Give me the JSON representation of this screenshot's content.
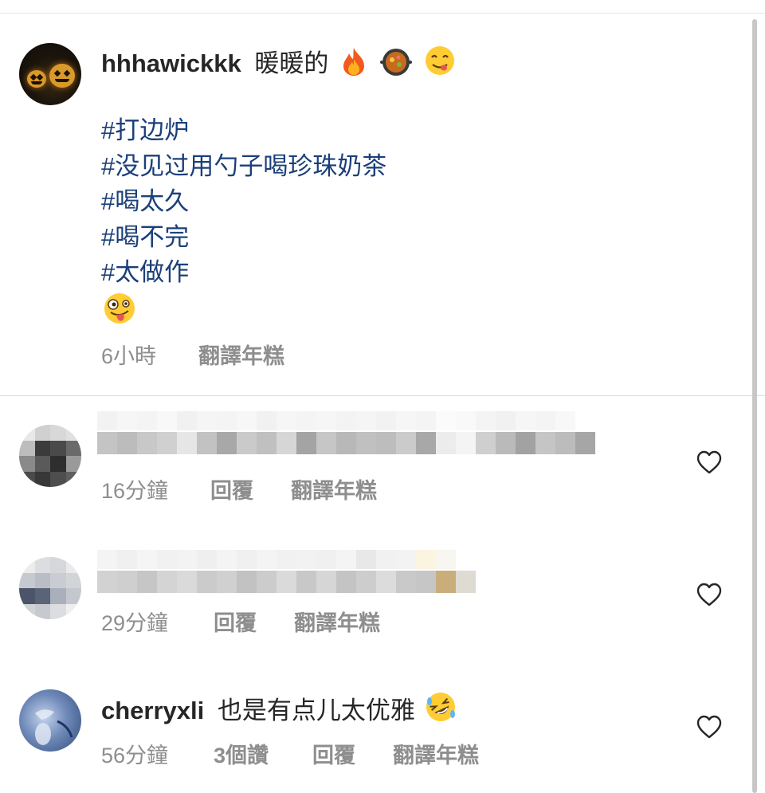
{
  "post": {
    "username": "hhhawickkk",
    "caption": "暖暖的",
    "caption_emojis": [
      "fire-emoji",
      "hotpot-emoji",
      "yum-face-emoji"
    ],
    "hashtags": [
      "#打边炉",
      "#没见过用勺子喝珍珠奶茶",
      "#喝太久",
      "#喝不完",
      "#太做作"
    ],
    "trailing_emoji": "zany-face-emoji",
    "time": "6小時",
    "translate": "翻譯年糕"
  },
  "comments": [
    {
      "username_hidden": true,
      "text_hidden": true,
      "time": "16分鐘",
      "reply": "回覆",
      "translate": "翻譯年糕",
      "heart": "heart-outline-icon"
    },
    {
      "username_hidden": true,
      "text_hidden": true,
      "time": "29分鐘",
      "reply": "回覆",
      "translate": "翻譯年糕",
      "heart": "heart-outline-icon"
    },
    {
      "username": "cherryxli",
      "text": "也是有点儿太优雅",
      "text_emoji": "rofl-face-emoji",
      "time": "56分鐘",
      "likes": "3個讚",
      "reply": "回覆",
      "translate": "翻譯年糕",
      "heart": "heart-outline-icon"
    }
  ],
  "colors": {
    "text": "#262626",
    "secondary": "#8e8e8e",
    "hashtag": "#1b3f7a",
    "divider": "#dbdbdb"
  }
}
